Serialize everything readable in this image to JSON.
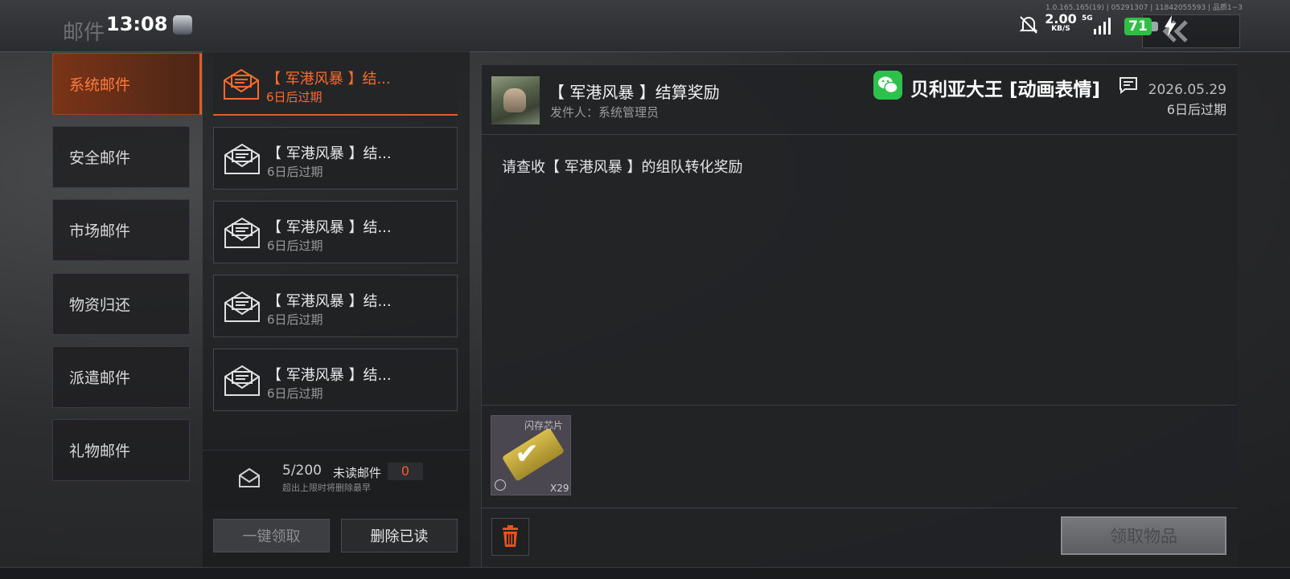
{
  "status_bar": {
    "ghost_title": "邮件",
    "time": "13:08",
    "net_speed_value": "2.00",
    "net_speed_unit": "KB/S",
    "network_type": "5G",
    "battery": "71",
    "version": "1.0.165.165(19) | 05291307 | 11842055593 | 品质1~3"
  },
  "categories": [
    {
      "label": "系统邮件",
      "active": true
    },
    {
      "label": "安全邮件",
      "active": false
    },
    {
      "label": "市场邮件",
      "active": false
    },
    {
      "label": "物资归还",
      "active": false
    },
    {
      "label": "派遣邮件",
      "active": false
    },
    {
      "label": "礼物邮件",
      "active": false
    }
  ],
  "mails": [
    {
      "title": "【 军港风暴 】结...",
      "expire": "6日后过期",
      "active": true
    },
    {
      "title": "【 军港风暴 】结...",
      "expire": "6日后过期",
      "active": false
    },
    {
      "title": "【 军港风暴 】结...",
      "expire": "6日后过期",
      "active": false
    },
    {
      "title": "【 军港风暴 】结...",
      "expire": "6日后过期",
      "active": false
    },
    {
      "title": "【 军港风暴 】结...",
      "expire": "6日后过期",
      "active": false
    }
  ],
  "mailbox": {
    "count": "5/200",
    "unread_label": "未读邮件",
    "unread_count": "0",
    "hint": "超出上限时将删除最早"
  },
  "actions": {
    "claim_all": "一键领取",
    "delete_read": "删除已读",
    "claim_items": "领取物品"
  },
  "detail": {
    "title": "【 军港风暴 】结算奖励",
    "sender": "发件人：系统管理员",
    "date": "2026.05.29",
    "expire": "6日后过期",
    "body": "请查收【 军港风暴 】的组队转化奖励",
    "overlay_text": "贝利亚大王 [动画表情]",
    "attachment": {
      "name": "闪存芯片",
      "quantity": "X29"
    }
  },
  "colors": {
    "accent": "#e25b2a",
    "wechat": "#2dc14b",
    "battery": "#2fbf45"
  }
}
